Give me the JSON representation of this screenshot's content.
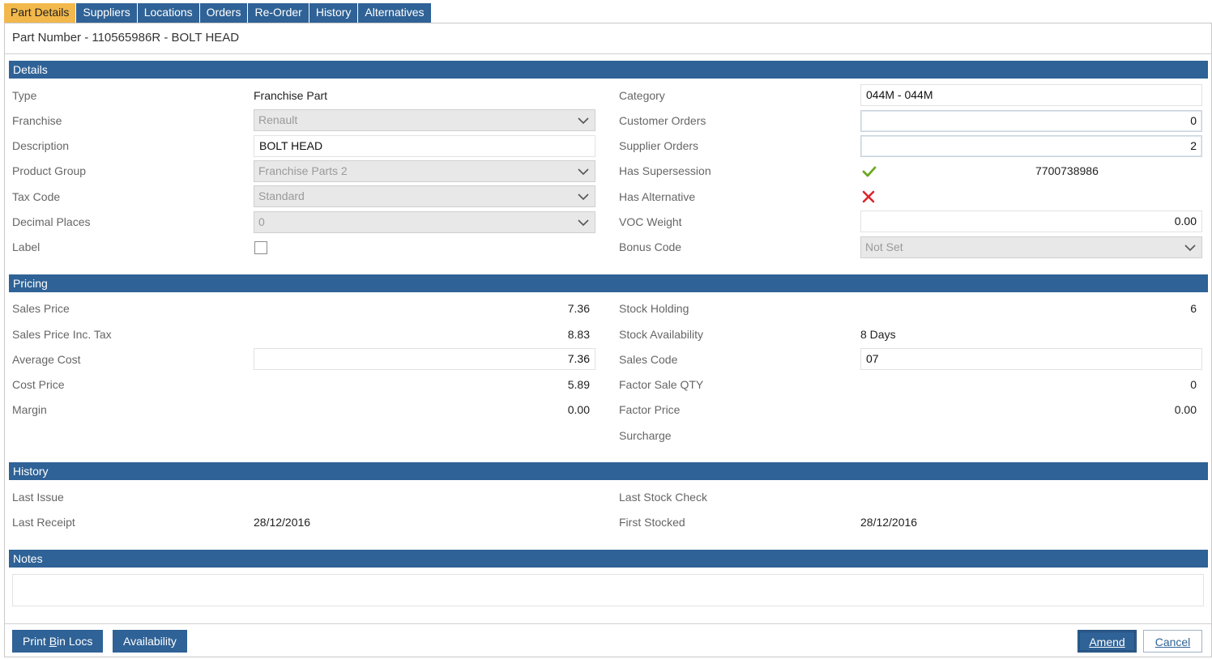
{
  "tabs": [
    {
      "label": "Part Details",
      "active": true
    },
    {
      "label": "Suppliers"
    },
    {
      "label": "Locations"
    },
    {
      "label": "Orders"
    },
    {
      "label": "Re-Order"
    },
    {
      "label": "History"
    },
    {
      "label": "Alternatives"
    }
  ],
  "part_title": "Part Number - 110565986R - BOLT HEAD",
  "sections": {
    "details": "Details",
    "pricing": "Pricing",
    "history": "History",
    "notes": "Notes"
  },
  "details": {
    "type_label": "Type",
    "type_value": "Franchise Part",
    "franchise_label": "Franchise",
    "franchise_value": "Renault",
    "description_label": "Description",
    "description_value": "BOLT HEAD",
    "product_group_label": "Product Group",
    "product_group_value": "Franchise Parts 2",
    "tax_code_label": "Tax Code",
    "tax_code_value": "Standard",
    "decimal_places_label": "Decimal Places",
    "decimal_places_value": "0",
    "label_label": "Label",
    "label_checked": false,
    "category_label": "Category",
    "category_value": "044M - 044M",
    "customer_orders_label": "Customer Orders",
    "customer_orders_value": "0",
    "supplier_orders_label": "Supplier Orders",
    "supplier_orders_value": "2",
    "has_supersession_label": "Has Supersession",
    "has_supersession": true,
    "supersession_number": "7700738986",
    "has_alternative_label": "Has Alternative",
    "has_alternative": false,
    "voc_weight_label": "VOC Weight",
    "voc_weight_value": "0.00",
    "bonus_code_label": "Bonus Code",
    "bonus_code_value": "Not Set"
  },
  "pricing": {
    "sales_price_label": "Sales Price",
    "sales_price": "7.36",
    "sales_price_inc_tax_label": "Sales Price Inc. Tax",
    "sales_price_inc_tax": "8.83",
    "average_cost_label": "Average Cost",
    "average_cost": "7.36",
    "cost_price_label": "Cost Price",
    "cost_price": "5.89",
    "margin_label": "Margin",
    "margin": "0.00",
    "stock_holding_label": "Stock Holding",
    "stock_holding": "6",
    "stock_availability_label": "Stock Availability",
    "stock_availability": "8 Days",
    "sales_code_label": "Sales Code",
    "sales_code": "07",
    "factor_sale_qty_label": "Factor Sale QTY",
    "factor_sale_qty": "0",
    "factor_price_label": "Factor Price",
    "factor_price": "0.00",
    "surcharge_label": "Surcharge"
  },
  "history": {
    "last_issue_label": "Last Issue",
    "last_receipt_label": "Last Receipt",
    "last_receipt": "28/12/2016",
    "last_stock_check_label": "Last Stock Check",
    "first_stocked_label": "First Stocked",
    "first_stocked": "28/12/2016"
  },
  "footer": {
    "print_bin_locs_prefix": "Print ",
    "print_bin_locs_key": "B",
    "print_bin_locs_suffix": "in Locs",
    "availability_label": "Availability",
    "amend_key": "A",
    "amend_suffix": "mend",
    "cancel_key": "C",
    "cancel_suffix": "ancel"
  },
  "colors": {
    "header_blue": "#2f6296",
    "active_tab": "#f2b84b",
    "check_green": "#6aa820",
    "cross_red": "#d9262b"
  }
}
